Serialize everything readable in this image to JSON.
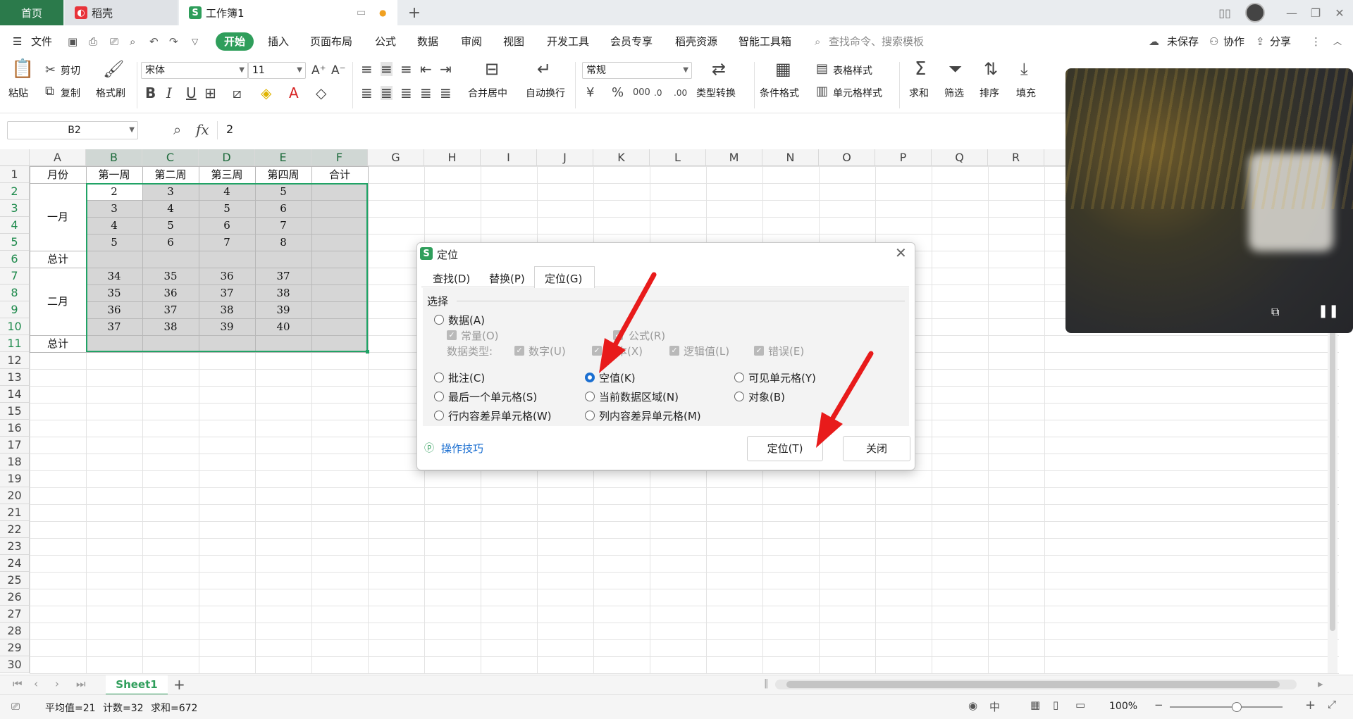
{
  "tabs": {
    "home": "首页",
    "docer": "稻壳",
    "workbook": "工作簿1",
    "new_tab": "+"
  },
  "menu": {
    "file": "文件",
    "items": [
      "开始",
      "插入",
      "页面布局",
      "公式",
      "数据",
      "审阅",
      "视图",
      "开发工具",
      "会员专享",
      "稻壳资源",
      "智能工具箱"
    ],
    "search_placeholder": "查找命令、搜索模板",
    "unsaved": "未保存",
    "collab": "协作",
    "share": "分享"
  },
  "ribbon": {
    "paste": "粘贴",
    "cut": "剪切",
    "copy": "复制",
    "format_painter": "格式刷",
    "font_name": "宋体",
    "font_size": "11",
    "bold": "B",
    "italic": "I",
    "underline": "U",
    "merge_center": "合并居中",
    "wrap_text": "自动换行",
    "number_format": "常规",
    "type_convert": "类型转换",
    "conditional_format": "条件格式",
    "table_style": "表格样式",
    "cell_style": "单元格样式",
    "sum": "求和",
    "filter": "筛选",
    "sort": "排序",
    "fill": "填充"
  },
  "formula_bar": {
    "name_box": "B2",
    "fx": "fx",
    "value": "2"
  },
  "columns": [
    "A",
    "B",
    "C",
    "D",
    "E",
    "F",
    "G",
    "H",
    "I",
    "J",
    "K",
    "L",
    "M",
    "N",
    "O",
    "P",
    "Q",
    "R"
  ],
  "rows": [
    "1",
    "2",
    "3",
    "4",
    "5",
    "6",
    "7",
    "8",
    "9",
    "10",
    "11",
    "12",
    "13",
    "14",
    "15",
    "16",
    "17",
    "18",
    "19",
    "20",
    "21",
    "22",
    "23",
    "24",
    "25",
    "26",
    "27",
    "28",
    "29",
    "30"
  ],
  "sheet": {
    "header": [
      "月份",
      "第一周",
      "第二周",
      "第三周",
      "第四周",
      "合计"
    ],
    "group1": "一月",
    "group2": "二月",
    "total": "总计",
    "data1": [
      [
        "2",
        "3",
        "4",
        "5"
      ],
      [
        "3",
        "4",
        "5",
        "6"
      ],
      [
        "4",
        "5",
        "6",
        "7"
      ],
      [
        "5",
        "6",
        "7",
        "8"
      ]
    ],
    "data2": [
      [
        "34",
        "35",
        "36",
        "37"
      ],
      [
        "35",
        "36",
        "37",
        "38"
      ],
      [
        "36",
        "37",
        "38",
        "39"
      ],
      [
        "37",
        "38",
        "39",
        "40"
      ]
    ]
  },
  "dialog": {
    "title": "定位",
    "tabs": [
      "查找(D)",
      "替换(P)",
      "定位(G)"
    ],
    "section": "选择",
    "data": "数据(A)",
    "constant": "常量(O)",
    "formula": "公式(R)",
    "data_type": "数据类型:",
    "number": "数字(U)",
    "text": "文本(X)",
    "logical": "逻辑值(L)",
    "error": "错误(E)",
    "comment": "批注(C)",
    "blank": "空值(K)",
    "visible": "可见单元格(Y)",
    "last_cell": "最后一个单元格(S)",
    "current_region": "当前数据区域(N)",
    "object": "对象(B)",
    "row_diff": "行内容差异单元格(W)",
    "col_diff": "列内容差异单元格(M)",
    "tips": "操作技巧",
    "locate_btn": "定位(T)",
    "close_btn": "关闭"
  },
  "sheet_tabs": {
    "active": "Sheet1",
    "add": "+"
  },
  "status": {
    "average": "平均值=21",
    "count": "计数=32",
    "sum": "求和=672",
    "zoom": "100%"
  },
  "colors": {
    "accent": "#2f9e5b",
    "selection_border": "#21a366",
    "arrow": "#e81b1b",
    "radio_on": "#1b6fd1"
  }
}
